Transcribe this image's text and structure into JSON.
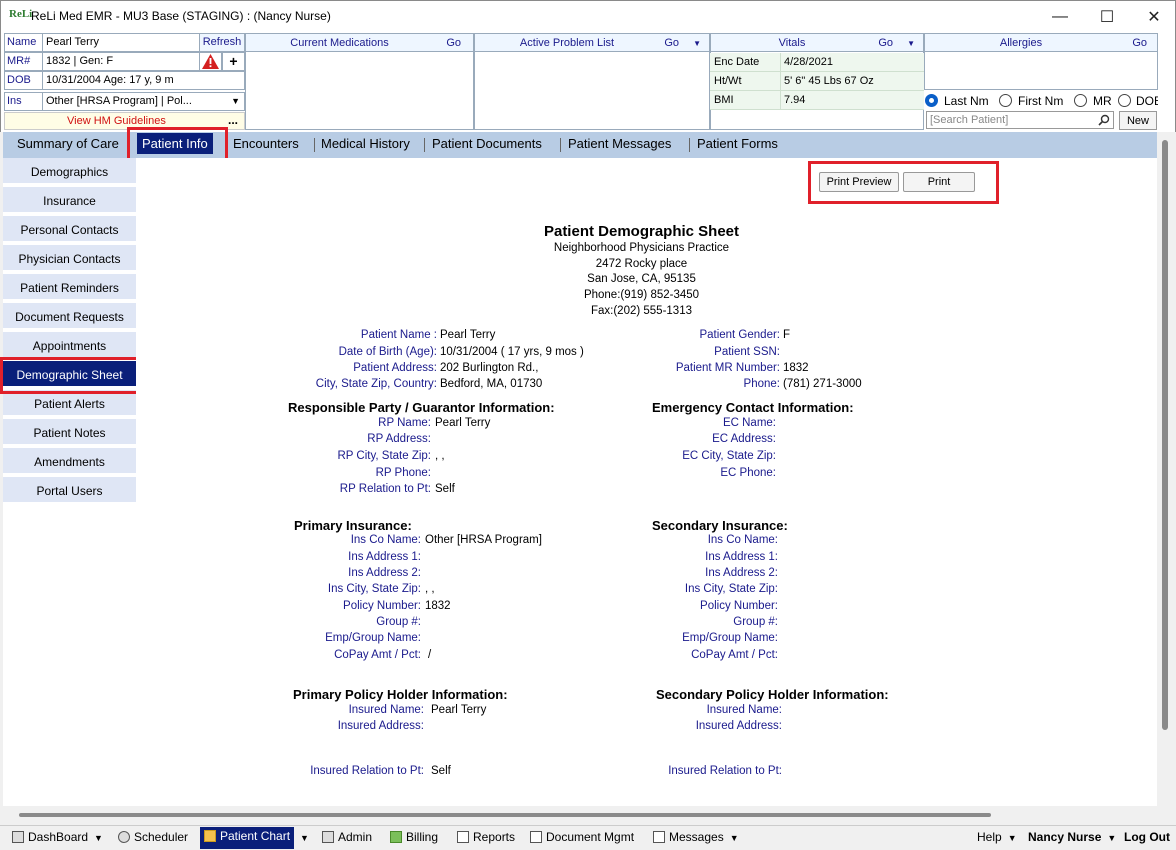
{
  "window": {
    "title": "ReLi Med EMR - MU3 Base (STAGING) : (Nancy Nurse)",
    "logo": "ReLi",
    "minimize": "—",
    "maximize": "☐",
    "close": "✕"
  },
  "patient_header": {
    "name_label": "Name",
    "name_value": "Pearl Terry",
    "refresh": "Refresh",
    "mr_label": "MR#",
    "mr_value": "1832 | Gen: F",
    "dob_label": "DOB",
    "dob_value": "10/31/2004  Age: 17 y, 9 m",
    "ins_label": "Ins",
    "ins_value": "Other [HRSA Program] | Pol...",
    "hm_link": "View HM Guidelines",
    "hm_more": "...",
    "add": "+"
  },
  "panels": {
    "current_medications": {
      "title": "Current Medications",
      "go": "Go"
    },
    "active_problem_list": {
      "title": "Active Problem List",
      "go": "Go"
    },
    "vitals": {
      "title": "Vitals",
      "go": "Go",
      "rows": [
        {
          "key": "Enc Date",
          "value": "4/28/2021"
        },
        {
          "key": "Ht/Wt",
          "value": "5' 6\" 45 Lbs 67 Oz"
        },
        {
          "key": "BMI",
          "value": "7.94"
        }
      ]
    },
    "allergies": {
      "title": "Allergies",
      "go": "Go"
    }
  },
  "search": {
    "radios": [
      "Last Nm",
      "First Nm",
      "MR",
      "DOB"
    ],
    "selected": "Last Nm",
    "placeholder": "[Search Patient]",
    "new": "New"
  },
  "tabs": [
    "Summary of Care",
    "Patient Info",
    "Encounters",
    "Medical History",
    "Patient Documents",
    "Patient Messages",
    "Patient Forms"
  ],
  "active_tab": "Patient Info",
  "sidebar": [
    "Demographics",
    "Insurance",
    "Personal Contacts",
    "Physician Contacts",
    "Patient Reminders",
    "Document Requests",
    "Appointments",
    "Demographic Sheet",
    "Patient Alerts",
    "Patient Notes",
    "Amendments",
    "Portal Users"
  ],
  "active_sidebar": "Demographic Sheet",
  "toolbar": {
    "print_preview": "Print Preview",
    "print": "Print"
  },
  "sheet": {
    "title": "Patient Demographic Sheet",
    "practice": "Neighborhood Physicians Practice",
    "street": "2472 Rocky place",
    "city": "San Jose, CA, 95135",
    "phone": "Phone:(919) 852-3450",
    "fax": "Fax:(202) 555-1313",
    "patient_left": [
      {
        "label": "Patient Name :",
        "value": "Pearl Terry"
      },
      {
        "label": "Date of Birth (Age):",
        "value": "10/31/2004 ( 17 yrs, 9 mos )"
      },
      {
        "label": "Patient Address:",
        "value": "202 Burlington Rd.,"
      },
      {
        "label": "City, State Zip, Country:",
        "value": "Bedford, MA, 01730"
      }
    ],
    "patient_right": [
      {
        "label": "Patient Gender:",
        "value": "F"
      },
      {
        "label": "Patient SSN:",
        "value": ""
      },
      {
        "label": "Patient MR Number:",
        "value": "1832"
      },
      {
        "label": "Phone:",
        "value": "(781) 271-3000"
      }
    ],
    "rp_heading": "Responsible Party / Guarantor Information:",
    "rp": [
      {
        "label": "RP Name:",
        "value": "Pearl Terry"
      },
      {
        "label": "RP Address:",
        "value": ""
      },
      {
        "label": "RP City, State Zip:",
        "value": ", ,"
      },
      {
        "label": "RP Phone:",
        "value": ""
      },
      {
        "label": "RP Relation to Pt:",
        "value": "Self"
      }
    ],
    "ec_heading": "Emergency Contact Information:",
    "ec": [
      {
        "label": "EC Name:",
        "value": ""
      },
      {
        "label": "EC Address:",
        "value": ""
      },
      {
        "label": "EC City, State Zip:",
        "value": ""
      },
      {
        "label": "EC Phone:",
        "value": ""
      }
    ],
    "pi_heading": "Primary Insurance:",
    "pi": [
      {
        "label": "Ins Co Name:",
        "value": "Other [HRSA Program]"
      },
      {
        "label": "Ins Address 1:",
        "value": ""
      },
      {
        "label": "Ins Address 2:",
        "value": ""
      },
      {
        "label": "Ins City, State Zip:",
        "value": ", ,"
      },
      {
        "label": "Policy Number:",
        "value": "1832"
      },
      {
        "label": "Group #:",
        "value": ""
      },
      {
        "label": "Emp/Group Name:",
        "value": ""
      },
      {
        "label": "CoPay Amt / Pct:",
        "value": "/"
      }
    ],
    "si_heading": "Secondary Insurance:",
    "si": [
      {
        "label": "Ins Co Name:",
        "value": ""
      },
      {
        "label": "Ins Address 1:",
        "value": ""
      },
      {
        "label": "Ins Address 2:",
        "value": ""
      },
      {
        "label": "Ins City, State Zip:",
        "value": ""
      },
      {
        "label": "Policy Number:",
        "value": ""
      },
      {
        "label": "Group #:",
        "value": ""
      },
      {
        "label": "Emp/Group Name:",
        "value": ""
      },
      {
        "label": "CoPay Amt / Pct:",
        "value": ""
      }
    ],
    "pph_heading": "Primary Policy Holder Information:",
    "pph": [
      {
        "label": "Insured Name:",
        "value": "Pearl Terry"
      },
      {
        "label": "Insured Address:",
        "value": ""
      }
    ],
    "pph_relation": {
      "label": "Insured Relation to Pt:",
      "value": "Self"
    },
    "sph_heading": "Secondary Policy Holder Information:",
    "sph": [
      {
        "label": "Insured Name:",
        "value": ""
      },
      {
        "label": "Insured Address:",
        "value": ""
      }
    ],
    "sph_relation": {
      "label": "Insured Relation to Pt:",
      "value": ""
    }
  },
  "taskbar": {
    "dashboard": "DashBoard",
    "scheduler": "Scheduler",
    "patient_chart": "Patient Chart",
    "admin": "Admin",
    "billing": "Billing",
    "reports": "Reports",
    "document_mgmt": "Document Mgmt",
    "messages": "Messages",
    "help": "Help",
    "user": "Nancy Nurse",
    "logout": "Log Out"
  },
  "colors": {
    "accent": "#0a1f7a",
    "highlight": "#e0202a",
    "tabbar": "#b8cce4",
    "sidebar": "#dfe6f5"
  }
}
